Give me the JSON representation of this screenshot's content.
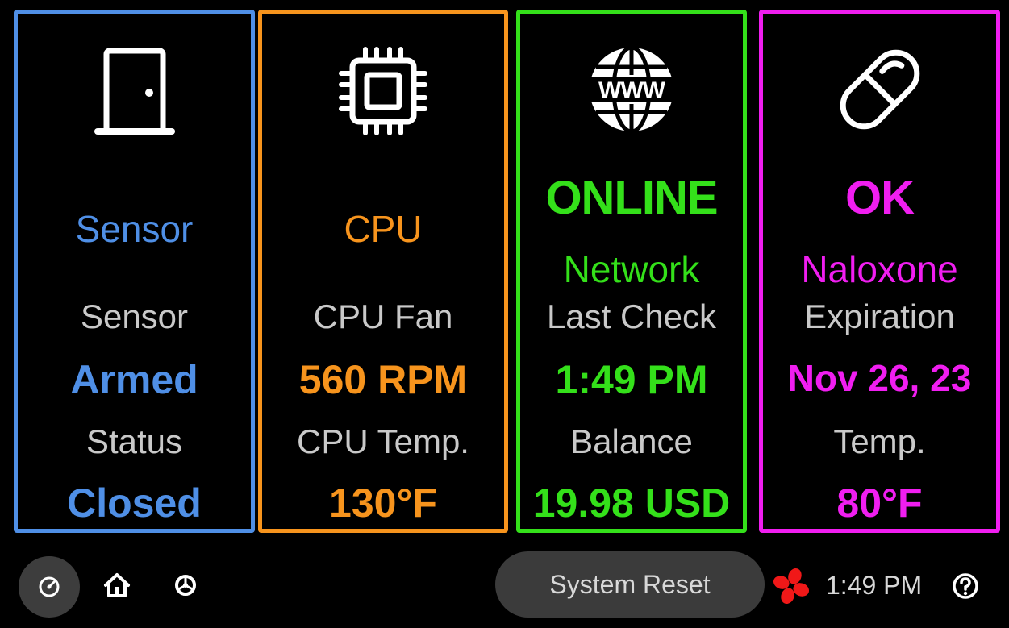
{
  "colors": {
    "sensor": "#4f8fe6",
    "cpu": "#f7941d",
    "network": "#34e01a",
    "medication": "#f01ef0",
    "label": "#c9c9c9"
  },
  "panels": {
    "sensor": {
      "icon": "door-icon",
      "title": "Sensor",
      "label1": "Sensor",
      "value1": "Armed",
      "label2": "Status",
      "value2": "Closed"
    },
    "cpu": {
      "icon": "cpu-chip-icon",
      "title": "CPU",
      "label1": "CPU Fan",
      "value1": "560 RPM",
      "label2": "CPU Temp.",
      "value2": "130°F"
    },
    "network": {
      "icon": "www-globe-icon",
      "status": "ONLINE",
      "title": "Network",
      "label1": "Last Check",
      "value1": "1:49 PM",
      "label2": "Balance",
      "value2": "19.98 USD"
    },
    "medication": {
      "icon": "pill-icon",
      "status": "OK",
      "title": "Naloxone",
      "label1": "Expiration",
      "value1": "Nov 26, 23",
      "label2": "Temp.",
      "value2": "80°F"
    }
  },
  "bottom_bar": {
    "dashboard_icon": "gauge-icon",
    "home_icon": "home-icon",
    "settings_icon": "gear-icon",
    "reset_label": "System Reset",
    "fan_icon": "fan-icon",
    "time": "1:49 PM",
    "help_icon": "help-icon"
  }
}
